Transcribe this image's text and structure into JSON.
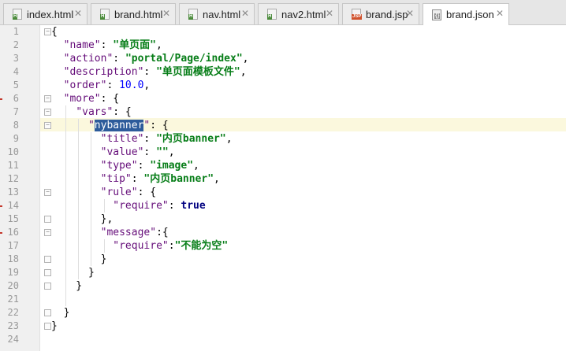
{
  "tabs": [
    {
      "label": "index.html",
      "icon": "html-file-icon",
      "badge": "H",
      "active": false
    },
    {
      "label": "brand.html",
      "icon": "html-file-icon",
      "badge": "H",
      "active": false
    },
    {
      "label": "nav.html",
      "icon": "html-file-icon",
      "badge": "H",
      "active": false
    },
    {
      "label": "nav2.html",
      "icon": "html-file-icon",
      "badge": "H",
      "active": false
    },
    {
      "label": "brand.jsp",
      "icon": "jsp-file-icon",
      "badge": "JSP",
      "active": false
    },
    {
      "label": "brand.json",
      "icon": "json-file-icon",
      "badge": "{}",
      "active": true
    }
  ],
  "editor": {
    "caret_line": 8,
    "selected_text": "nybanner",
    "error_lines": [
      6,
      14,
      16
    ],
    "line_numbers": [
      "1",
      "2",
      "3",
      "4",
      "5",
      "6",
      "7",
      "8",
      "9",
      "10",
      "11",
      "12",
      "13",
      "14",
      "15",
      "16",
      "17",
      "18",
      "19",
      "20",
      "21",
      "22",
      "23",
      "24"
    ],
    "lines": [
      [
        {
          "t": "{",
          "c": ""
        }
      ],
      [
        {
          "t": "  ",
          "c": ""
        },
        {
          "t": "\"name\"",
          "c": "k"
        },
        {
          "t": ": ",
          "c": ""
        },
        {
          "t": "\"单页面\"",
          "c": "s"
        },
        {
          "t": ",",
          "c": ""
        }
      ],
      [
        {
          "t": "  ",
          "c": ""
        },
        {
          "t": "\"action\"",
          "c": "k"
        },
        {
          "t": ": ",
          "c": ""
        },
        {
          "t": "\"portal/Page/index\"",
          "c": "s"
        },
        {
          "t": ",",
          "c": ""
        }
      ],
      [
        {
          "t": "  ",
          "c": ""
        },
        {
          "t": "\"description\"",
          "c": "k"
        },
        {
          "t": ": ",
          "c": ""
        },
        {
          "t": "\"单页面模板文件\"",
          "c": "s"
        },
        {
          "t": ",",
          "c": ""
        }
      ],
      [
        {
          "t": "  ",
          "c": ""
        },
        {
          "t": "\"order\"",
          "c": "k"
        },
        {
          "t": ": ",
          "c": ""
        },
        {
          "t": "10.0",
          "c": "n"
        },
        {
          "t": ",",
          "c": ""
        }
      ],
      [
        {
          "t": "  ",
          "c": ""
        },
        {
          "t": "\"more\"",
          "c": "k"
        },
        {
          "t": ": {",
          "c": ""
        }
      ],
      [
        {
          "t": "    ",
          "c": ""
        },
        {
          "t": "\"vars\"",
          "c": "k"
        },
        {
          "t": ": {",
          "c": ""
        }
      ],
      [
        {
          "t": "      ",
          "c": ""
        },
        {
          "t": "\"",
          "c": "k"
        },
        {
          "t": "nybanner",
          "c": "sel"
        },
        {
          "t": "\"",
          "c": "k"
        },
        {
          "t": ": {",
          "c": ""
        }
      ],
      [
        {
          "t": "        ",
          "c": ""
        },
        {
          "t": "\"title\"",
          "c": "k"
        },
        {
          "t": ": ",
          "c": ""
        },
        {
          "t": "\"内页banner\"",
          "c": "s"
        },
        {
          "t": ",",
          "c": ""
        }
      ],
      [
        {
          "t": "        ",
          "c": ""
        },
        {
          "t": "\"value\"",
          "c": "k"
        },
        {
          "t": ": ",
          "c": ""
        },
        {
          "t": "\"\"",
          "c": "s"
        },
        {
          "t": ",",
          "c": ""
        }
      ],
      [
        {
          "t": "        ",
          "c": ""
        },
        {
          "t": "\"type\"",
          "c": "k"
        },
        {
          "t": ": ",
          "c": ""
        },
        {
          "t": "\"image\"",
          "c": "s"
        },
        {
          "t": ",",
          "c": ""
        }
      ],
      [
        {
          "t": "        ",
          "c": ""
        },
        {
          "t": "\"tip\"",
          "c": "k"
        },
        {
          "t": ": ",
          "c": ""
        },
        {
          "t": "\"内页banner\"",
          "c": "s"
        },
        {
          "t": ",",
          "c": ""
        }
      ],
      [
        {
          "t": "        ",
          "c": ""
        },
        {
          "t": "\"rule\"",
          "c": "k"
        },
        {
          "t": ": {",
          "c": ""
        }
      ],
      [
        {
          "t": "          ",
          "c": ""
        },
        {
          "t": "\"require\"",
          "c": "k"
        },
        {
          "t": ": ",
          "c": ""
        },
        {
          "t": "true",
          "c": "b"
        }
      ],
      [
        {
          "t": "        },",
          "c": ""
        }
      ],
      [
        {
          "t": "        ",
          "c": ""
        },
        {
          "t": "\"message\"",
          "c": "k"
        },
        {
          "t": ":{",
          "c": ""
        }
      ],
      [
        {
          "t": "          ",
          "c": ""
        },
        {
          "t": "\"require\"",
          "c": "k"
        },
        {
          "t": ":",
          "c": ""
        },
        {
          "t": "\"不能为空\"",
          "c": "s"
        }
      ],
      [
        {
          "t": "        }",
          "c": ""
        }
      ],
      [
        {
          "t": "      }",
          "c": ""
        }
      ],
      [
        {
          "t": "    }",
          "c": ""
        }
      ],
      [
        {
          "t": "",
          "c": ""
        }
      ],
      [
        {
          "t": "  }",
          "c": ""
        }
      ],
      [
        {
          "t": "}",
          "c": ""
        }
      ],
      [
        {
          "t": "",
          "c": ""
        }
      ]
    ]
  },
  "colors": {
    "key": "#660e7a",
    "string": "#067d17",
    "number": "#0000ff",
    "keyword": "#000080",
    "selection": "#2d5b9b",
    "caret_line": "#fbf8dd",
    "error_mark": "#c4382c"
  }
}
